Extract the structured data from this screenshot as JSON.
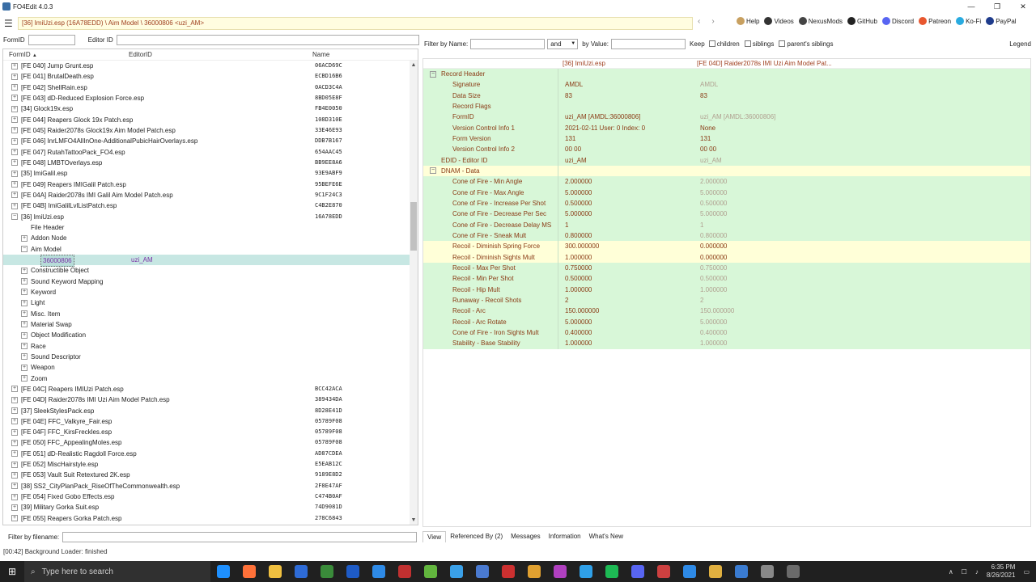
{
  "app": {
    "title": "FO4Edit 4.0.3",
    "window_controls": [
      "—",
      "❐",
      "✕"
    ]
  },
  "toolbar": {
    "path": "[36] ImiUzi.esp (16A78EDD) \\ Aim Model \\ 36000806 <uzi_AM>",
    "links": [
      {
        "label": "Help",
        "icon": "book-icon",
        "color": "#c8a060"
      },
      {
        "label": "Videos",
        "icon": "video-icon",
        "color": "#333333"
      },
      {
        "label": "NexusMods",
        "icon": "nexus-icon",
        "color": "#444444"
      },
      {
        "label": "GitHub",
        "icon": "github-icon",
        "color": "#222222"
      },
      {
        "label": "Discord",
        "icon": "discord-icon",
        "color": "#5865f2"
      },
      {
        "label": "Patreon",
        "icon": "patreon-icon",
        "color": "#e8572f"
      },
      {
        "label": "Ko-Fi",
        "icon": "kofi-icon",
        "color": "#29abe0"
      },
      {
        "label": "PayPal",
        "icon": "paypal-icon",
        "color": "#1f3c8c"
      }
    ]
  },
  "left": {
    "formid_label": "FormID",
    "editorid_label": "Editor ID",
    "columns": {
      "formid": "FormID",
      "editorid": "EditorID",
      "name": "Name"
    },
    "sort_indicator": "▲",
    "rows": [
      {
        "lvl": 0,
        "exp": "+",
        "name": "[FE 040] Jump Grunt.esp",
        "fid": "06ACD69C"
      },
      {
        "lvl": 0,
        "exp": "+",
        "name": "[FE 041] BrutalDeath.esp",
        "fid": "ECBD16B6"
      },
      {
        "lvl": 0,
        "exp": "+",
        "name": "[FE 042] ShellRain.esp",
        "fid": "0ACD3C4A"
      },
      {
        "lvl": 0,
        "exp": "+",
        "name": "[FE 043] dD-Reduced Explosion Force.esp",
        "fid": "8BD05E8F"
      },
      {
        "lvl": 0,
        "exp": "+",
        "name": "[34] Glock19x.esp",
        "fid": "FB4E0050"
      },
      {
        "lvl": 0,
        "exp": "+",
        "name": "[FE 044] Reapers Glock 19x Patch.esp",
        "fid": "108D310E"
      },
      {
        "lvl": 0,
        "exp": "+",
        "name": "[FE 045] Raider2078s Glock19x Aim Model Patch.esp",
        "fid": "33E46E93"
      },
      {
        "lvl": 0,
        "exp": "+",
        "name": "[FE 046] InrLMFO4AllInOne-AdditionalPubicHairOverlays.esp",
        "fid": "DDB7B167"
      },
      {
        "lvl": 0,
        "exp": "+",
        "name": "[FE 047] RutahTattooPack_FO4.esp",
        "fid": "654AAC45"
      },
      {
        "lvl": 0,
        "exp": "+",
        "name": "[FE 048] LMBTOverlays.esp",
        "fid": "BB9EE8A6"
      },
      {
        "lvl": 0,
        "exp": "+",
        "name": "[35] ImiGalil.esp",
        "fid": "93E9ABF9"
      },
      {
        "lvl": 0,
        "exp": "+",
        "name": "[FE 049] Reapers IMIGalil Patch.esp",
        "fid": "95BEFE6E"
      },
      {
        "lvl": 0,
        "exp": "+",
        "name": "[FE 04A] Raider2078s IMI Galil Aim Model Patch.esp",
        "fid": "9C1F24C3"
      },
      {
        "lvl": 0,
        "exp": "+",
        "name": "[FE 04B] ImiGalilLvlListPatch.esp",
        "fid": "C4B2E870"
      },
      {
        "lvl": 0,
        "exp": "−",
        "name": "[36] ImiUzi.esp",
        "fid": "16A78EDD"
      },
      {
        "lvl": 1,
        "exp": "",
        "name": "File Header",
        "fid": ""
      },
      {
        "lvl": 1,
        "exp": "+",
        "name": "Addon Node",
        "fid": ""
      },
      {
        "lvl": 1,
        "exp": "−",
        "name": "Aim Model",
        "fid": ""
      },
      {
        "lvl": 2,
        "exp": "",
        "name": "36000806",
        "fid": "",
        "edid": "uzi_AM",
        "sel": true
      },
      {
        "lvl": 1,
        "exp": "+",
        "name": "Constructible Object",
        "fid": ""
      },
      {
        "lvl": 1,
        "exp": "+",
        "name": "Sound Keyword Mapping",
        "fid": ""
      },
      {
        "lvl": 1,
        "exp": "+",
        "name": "Keyword",
        "fid": ""
      },
      {
        "lvl": 1,
        "exp": "+",
        "name": "Light",
        "fid": ""
      },
      {
        "lvl": 1,
        "exp": "+",
        "name": "Misc. Item",
        "fid": ""
      },
      {
        "lvl": 1,
        "exp": "+",
        "name": "Material Swap",
        "fid": ""
      },
      {
        "lvl": 1,
        "exp": "+",
        "name": "Object Modification",
        "fid": ""
      },
      {
        "lvl": 1,
        "exp": "+",
        "name": "Race",
        "fid": ""
      },
      {
        "lvl": 1,
        "exp": "+",
        "name": "Sound Descriptor",
        "fid": ""
      },
      {
        "lvl": 1,
        "exp": "+",
        "name": "Weapon",
        "fid": ""
      },
      {
        "lvl": 1,
        "exp": "+",
        "name": "Zoom",
        "fid": ""
      },
      {
        "lvl": 0,
        "exp": "+",
        "name": "[FE 04C] Reapers IMIUzi Patch.esp",
        "fid": "BCC42ACA"
      },
      {
        "lvl": 0,
        "exp": "+",
        "name": "[FE 04D] Raider2078s IMI Uzi Aim Model Patch.esp",
        "fid": "389434DA"
      },
      {
        "lvl": 0,
        "exp": "+",
        "name": "[37] SleekStylesPack.esp",
        "fid": "8D28E41D"
      },
      {
        "lvl": 0,
        "exp": "+",
        "name": "[FE 04E] FFC_Valkyre_Fair.esp",
        "fid": "05789F08"
      },
      {
        "lvl": 0,
        "exp": "+",
        "name": "[FE 04F] FFC_KirsFreckles.esp",
        "fid": "05789F08"
      },
      {
        "lvl": 0,
        "exp": "+",
        "name": "[FE 050] FFC_AppealingMoles.esp",
        "fid": "05789F08"
      },
      {
        "lvl": 0,
        "exp": "+",
        "name": "[FE 051] dD-Realistic Ragdoll Force.esp",
        "fid": "AD87CDEA"
      },
      {
        "lvl": 0,
        "exp": "+",
        "name": "[FE 052] MiscHairstyle.esp",
        "fid": "E5EAB12C"
      },
      {
        "lvl": 0,
        "exp": "+",
        "name": "[FE 053] Vault Suit Retextured 2K.esp",
        "fid": "9189E8D2"
      },
      {
        "lvl": 0,
        "exp": "+",
        "name": "[38] SS2_CityPlanPack_RiseOfTheCommonwealth.esp",
        "fid": "2F8E47AF"
      },
      {
        "lvl": 0,
        "exp": "+",
        "name": "[FE 054] Fixed Gobo Effects.esp",
        "fid": "C474B0AF"
      },
      {
        "lvl": 0,
        "exp": "+",
        "name": "[39] Military Gorka Suit.esp",
        "fid": "74D9081D"
      },
      {
        "lvl": 0,
        "exp": "+",
        "name": "[FE 055] Reapers Gorka Patch.esp",
        "fid": "278C6843"
      }
    ],
    "filter_filename_label": "Filter by filename:"
  },
  "right": {
    "filter_name_label": "Filter by Name:",
    "and_option": "and",
    "by_value_label": "by Value:",
    "keep_label": "Keep",
    "children_label": "children",
    "siblings_label": "siblings",
    "parents_siblings_label": "parent's siblings",
    "legend_label": "Legend",
    "col1": "[36] ImiUzi.esp",
    "col2": "[FE 04D] Raider2078s IMI Uzi Aim Model Pat...",
    "rows": [
      {
        "indent": 0,
        "exp": "−",
        "label": "Record Header",
        "v1": "",
        "v2": "",
        "bg": "green",
        "dim": false
      },
      {
        "indent": 1,
        "exp": "",
        "label": "Signature",
        "v1": "AMDL",
        "v2": "AMDL",
        "bg": "green",
        "dim": true
      },
      {
        "indent": 1,
        "exp": "",
        "label": "Data Size",
        "v1": "83",
        "v2": "83",
        "bg": "green",
        "dim": false
      },
      {
        "indent": 1,
        "exp": "",
        "label": "Record Flags",
        "v1": "",
        "v2": "",
        "bg": "green",
        "dim": false
      },
      {
        "indent": 1,
        "exp": "",
        "label": "FormID",
        "v1": "uzi_AM [AMDL:36000806]",
        "v2": "uzi_AM [AMDL:36000806]",
        "bg": "green",
        "dim": true
      },
      {
        "indent": 1,
        "exp": "",
        "label": "Version Control Info 1",
        "v1": "2021-02-11 User: 0 Index: 0",
        "v2": "None",
        "bg": "green",
        "dim": false
      },
      {
        "indent": 1,
        "exp": "",
        "label": "Form Version",
        "v1": "131",
        "v2": "131",
        "bg": "green",
        "dim": false
      },
      {
        "indent": 1,
        "exp": "",
        "label": "Version Control Info 2",
        "v1": "00 00",
        "v2": "00 00",
        "bg": "green",
        "dim": false
      },
      {
        "indent": 0,
        "exp": "",
        "label": "EDID - Editor ID",
        "v1": "uzi_AM",
        "v2": "uzi_AM",
        "bg": "green",
        "dim": true
      },
      {
        "indent": 0,
        "exp": "−",
        "label": "DNAM - Data",
        "v1": "",
        "v2": "",
        "bg": "yellow",
        "dim": false
      },
      {
        "indent": 1,
        "exp": "",
        "label": "Cone of Fire - Min Angle",
        "v1": "2.000000",
        "v2": "2.000000",
        "bg": "green",
        "dim": true
      },
      {
        "indent": 1,
        "exp": "",
        "label": "Cone of Fire - Max Angle",
        "v1": "5.000000",
        "v2": "5.000000",
        "bg": "green",
        "dim": true
      },
      {
        "indent": 1,
        "exp": "",
        "label": "Cone of Fire - Increase Per Shot",
        "v1": "0.500000",
        "v2": "0.500000",
        "bg": "green",
        "dim": true
      },
      {
        "indent": 1,
        "exp": "",
        "label": "Cone of Fire - Decrease Per Sec",
        "v1": "5.000000",
        "v2": "5.000000",
        "bg": "green",
        "dim": true
      },
      {
        "indent": 1,
        "exp": "",
        "label": "Cone of Fire - Decrease Delay MS",
        "v1": "1",
        "v2": "1",
        "bg": "green",
        "dim": true
      },
      {
        "indent": 1,
        "exp": "",
        "label": "Cone of Fire - Sneak Mult",
        "v1": "0.800000",
        "v2": "0.800000",
        "bg": "green",
        "dim": true
      },
      {
        "indent": 1,
        "exp": "",
        "label": "Recoil - Diminish Spring Force",
        "v1": "300.000000",
        "v2": "0.000000",
        "bg": "yellow",
        "dim": false
      },
      {
        "indent": 1,
        "exp": "",
        "label": "Recoil - Diminish Sights Mult",
        "v1": "1.000000",
        "v2": "0.000000",
        "bg": "yellow",
        "dim": false
      },
      {
        "indent": 1,
        "exp": "",
        "label": "Recoil - Max Per Shot",
        "v1": "0.750000",
        "v2": "0.750000",
        "bg": "green",
        "dim": true
      },
      {
        "indent": 1,
        "exp": "",
        "label": "Recoil - Min Per Shot",
        "v1": "0.500000",
        "v2": "0.500000",
        "bg": "green",
        "dim": true
      },
      {
        "indent": 1,
        "exp": "",
        "label": "Recoil - Hip Mult",
        "v1": "1.000000",
        "v2": "1.000000",
        "bg": "green",
        "dim": true
      },
      {
        "indent": 1,
        "exp": "",
        "label": "Runaway - Recoil Shots",
        "v1": "2",
        "v2": "2",
        "bg": "green",
        "dim": true
      },
      {
        "indent": 1,
        "exp": "",
        "label": "Recoil - Arc",
        "v1": "150.000000",
        "v2": "150.000000",
        "bg": "green",
        "dim": true
      },
      {
        "indent": 1,
        "exp": "",
        "label": "Recoil - Arc Rotate",
        "v1": "5.000000",
        "v2": "5.000000",
        "bg": "green",
        "dim": true
      },
      {
        "indent": 1,
        "exp": "",
        "label": "Cone of Fire - Iron Sights Mult",
        "v1": "0.400000",
        "v2": "0.400000",
        "bg": "green",
        "dim": true
      },
      {
        "indent": 1,
        "exp": "",
        "label": "Stability - Base Stability",
        "v1": "1.000000",
        "v2": "1.000000",
        "bg": "green",
        "dim": true
      }
    ],
    "tabs": [
      "View",
      "Referenced By (2)",
      "Messages",
      "Information",
      "What's New"
    ]
  },
  "status": "[00:42] Background Loader: finished",
  "taskbar": {
    "search_placeholder": "Type here to search",
    "icons": [
      "#1e90ff",
      "#ff7139",
      "#f0c040",
      "#2e6bd6",
      "#3a8b3a",
      "#1e5bc6",
      "#2e8ae6",
      "#c03030",
      "#62b53e",
      "#3aa0e8",
      "#4a7ad0",
      "#cc3030",
      "#e0a030",
      "#b040c0",
      "#2fa0e8",
      "#1db954",
      "#5865f2",
      "#cc4040",
      "#2e8ae6",
      "#e0b040",
      "#3a7bd0",
      "#888888",
      "#6a6a6a"
    ],
    "time": "6:35 PM",
    "date": "8/26/2021"
  }
}
